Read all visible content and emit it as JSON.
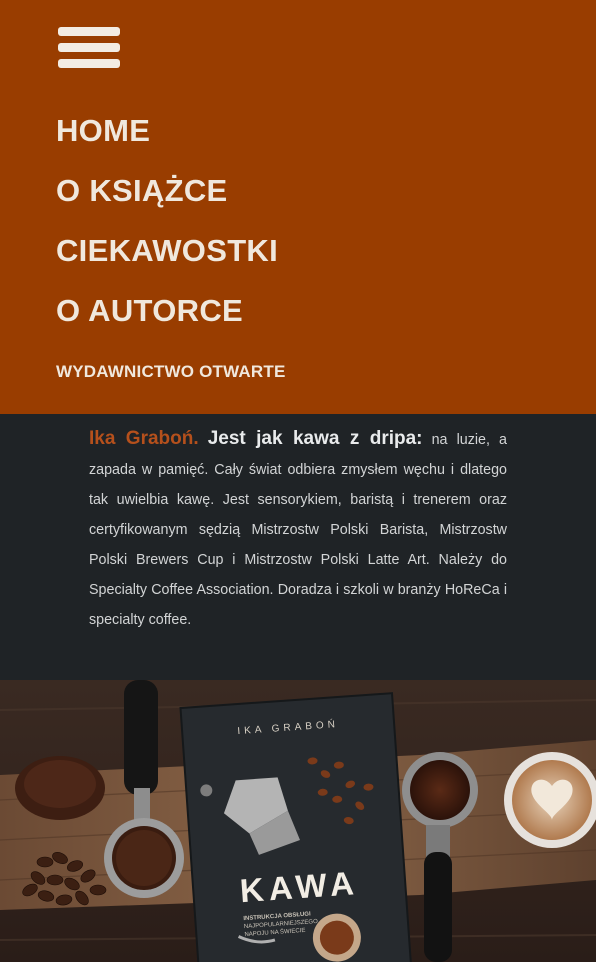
{
  "menu": {
    "toggle_icon": "hamburger-icon",
    "items": [
      {
        "label": "HOME"
      },
      {
        "label": "O KSIĄŻCE"
      },
      {
        "label": "CIEKAWOSTKI"
      },
      {
        "label": "O AUTORCE"
      }
    ],
    "publisher": "WYDAWNICTWO OTWARTE"
  },
  "bio": {
    "name": "Ika Graboń.",
    "lead": "Jest jak kawa z dripa:",
    "text": "na luzie, a zapada w pamięć. Cały świat odbiera zmysłem węchu i dlatego tak uwielbia kawę. Jest sensorykiem, baristą i trenerem oraz certyfikowanym sędzią Mistrzostw Polski Barista, Mistrzostw Polski Brewers Cup i Mistrzostw Polski Latte Art. Należy do Specialty Coffee Association. Doradza i szkoli w branży HoReCa i specialty coffee."
  },
  "book": {
    "author": "IKA GRABOŃ",
    "title": "KAWA",
    "subtitle_lines": [
      "INSTRUKCJA OBSŁUGI",
      "NAJPOPULARNIEJSZEGO",
      "NAPOJU NA ŚWIECIE"
    ]
  },
  "colors": {
    "menu_bg": "#993d00",
    "content_bg": "#1f2326",
    "accent": "#b5501c",
    "menu_text": "#f0e8dd"
  }
}
